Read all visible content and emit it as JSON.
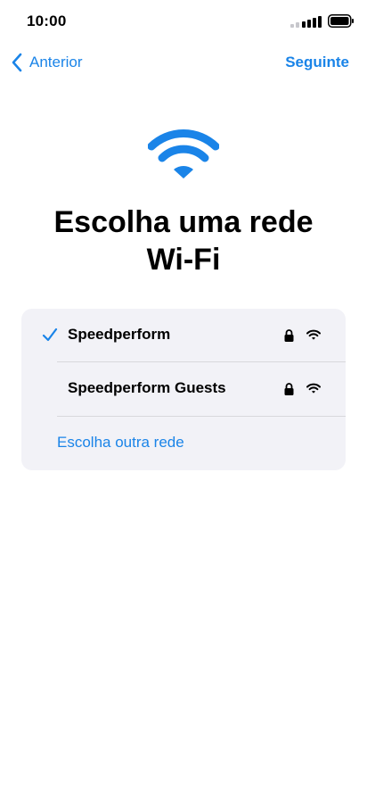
{
  "status_bar": {
    "time": "10:00"
  },
  "nav": {
    "back_label": "Anterior",
    "next_label": "Seguinte"
  },
  "title": "Escolha uma rede Wi-Fi",
  "networks": [
    {
      "name": "Speedperform",
      "selected": true,
      "locked": true
    },
    {
      "name": "Speedperform Guests",
      "selected": false,
      "locked": true
    }
  ],
  "other_network_label": "Escolha outra rede",
  "icons": {
    "back": "chevron-left-icon",
    "hero": "wifi-icon",
    "check": "checkmark-icon",
    "lock": "lock-icon",
    "signal": "wifi-signal-icon"
  },
  "colors": {
    "accent": "#1a84e8",
    "list_background": "#f2f2f7",
    "divider": "#d8d8dc"
  }
}
